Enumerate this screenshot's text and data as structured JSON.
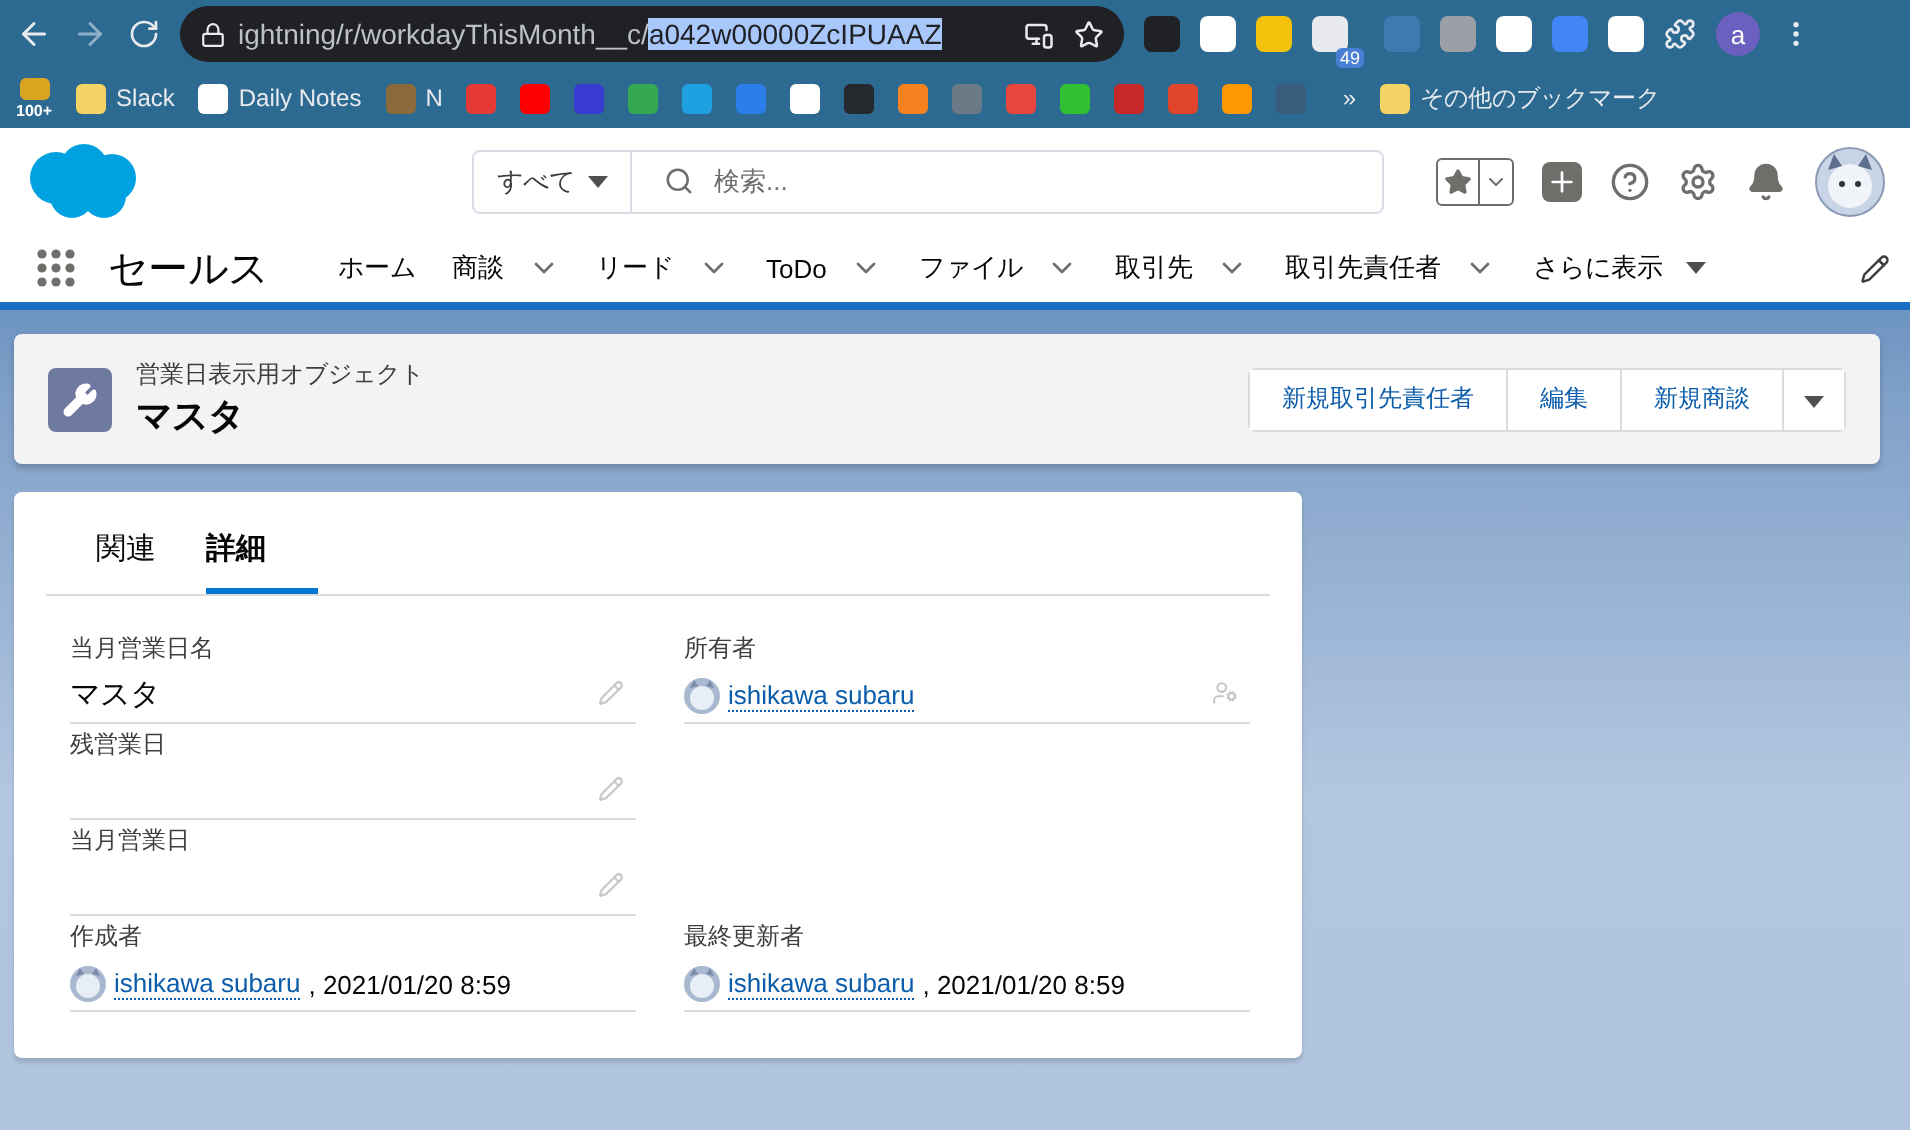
{
  "browser": {
    "url_prefix": "ightning/r/workdayThisMonth__c/",
    "url_selected": "a042w00000ZcIPUAAZ",
    "extensions": [
      {
        "color": "#202124"
      },
      {
        "color": "#ffffff"
      },
      {
        "color": "#f4c20d"
      },
      {
        "color": "#e8eaed",
        "badge": "49"
      },
      {
        "color": "#3c7ab0"
      },
      {
        "color": "#9aa0a6"
      },
      {
        "color": "#ffffff"
      },
      {
        "color": "#4285f4"
      },
      {
        "color": "#ffffff"
      }
    ],
    "profile": "a",
    "bookmarks": [
      {
        "color": "#d9a520",
        "badge": "100+"
      },
      {
        "color": "#f6d365",
        "label": "Slack"
      },
      {
        "color": "#ffffff",
        "label": "Daily Notes"
      },
      {
        "color": "#8a6a3a",
        "label": "N"
      },
      {
        "color": "#e53935"
      },
      {
        "color": "#ff0000"
      },
      {
        "color": "#3a3ad0"
      },
      {
        "color": "#34a853"
      },
      {
        "color": "#1fa0e0"
      },
      {
        "color": "#2b7de9"
      },
      {
        "color": "#ffffff"
      },
      {
        "color": "#24292e"
      },
      {
        "color": "#f5821f"
      },
      {
        "color": "#6b7a86"
      },
      {
        "color": "#e8453c"
      },
      {
        "color": "#30c030"
      },
      {
        "color": "#c62828"
      },
      {
        "color": "#e0452b"
      },
      {
        "color": "#ff9800"
      },
      {
        "color": "#3b5d7c"
      }
    ],
    "more_bookmarks": "»",
    "other_bookmarks": "その他のブックマーク"
  },
  "header": {
    "search_scope": "すべて",
    "search_placeholder": "検索..."
  },
  "nav": {
    "app_name": "セールス",
    "items": [
      {
        "label": "ホーム",
        "has_menu": false
      },
      {
        "label": "商談",
        "has_menu": true
      },
      {
        "label": "リード",
        "has_menu": true
      },
      {
        "label": "ToDo",
        "has_menu": true
      },
      {
        "label": "ファイル",
        "has_menu": true
      },
      {
        "label": "取引先",
        "has_menu": true
      },
      {
        "label": "取引先責任者",
        "has_menu": true
      }
    ],
    "more": "さらに表示"
  },
  "record": {
    "object_type": "営業日表示用オブジェクト",
    "title": "マスタ",
    "actions": [
      "新規取引先責任者",
      "編集",
      "新規商談"
    ]
  },
  "tabs": [
    {
      "label": "関連",
      "selected": false
    },
    {
      "label": "詳細",
      "selected": true
    }
  ],
  "rows": [
    {
      "left": {
        "label": "当月営業日名",
        "kind": "text",
        "value": "マスタ"
      },
      "right": {
        "label": "所有者",
        "kind": "owner",
        "user": "ishikawa subaru"
      }
    },
    {
      "left": {
        "label": "残営業日",
        "kind": "text"
      }
    },
    {
      "left": {
        "label": "当月営業日",
        "kind": "text"
      }
    },
    {
      "left": {
        "label": "作成者",
        "kind": "stamp",
        "user": "ishikawa subaru",
        "date": ", 2021/01/20 8:59"
      },
      "right": {
        "label": "最終更新者",
        "kind": "stamp",
        "user": "ishikawa subaru",
        "date": ", 2021/01/20 8:59"
      }
    }
  ]
}
